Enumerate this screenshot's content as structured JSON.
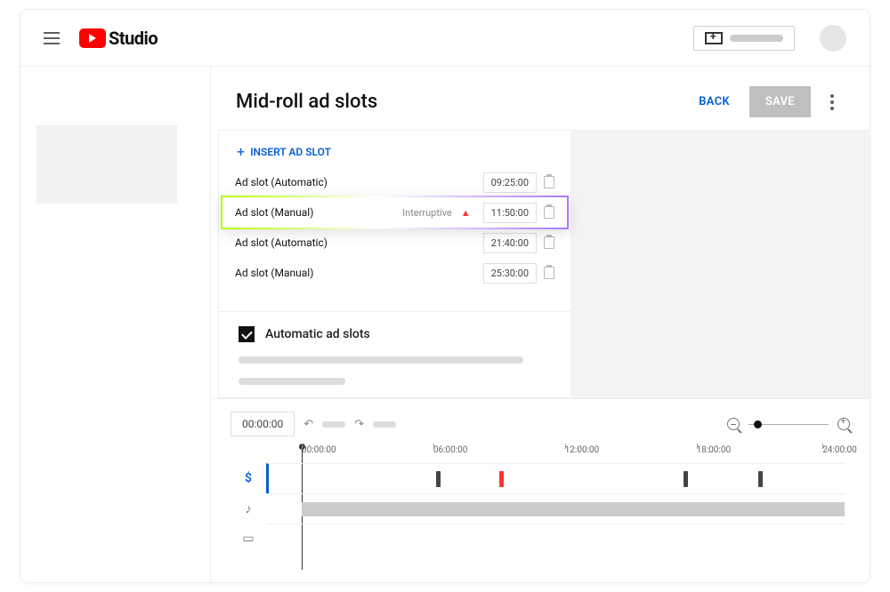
{
  "header": {
    "logo_text": "Studio"
  },
  "page": {
    "title": "Mid-roll ad slots",
    "back_label": "BACK",
    "save_label": "SAVE"
  },
  "panel": {
    "insert_label": "INSERT AD SLOT",
    "slots": [
      {
        "label": "Ad slot (Automatic)",
        "time": "09:25:00",
        "warn": "",
        "highlight": false
      },
      {
        "label": "Ad slot (Manual)",
        "time": "11:50:00",
        "warn": "Interruptive",
        "highlight": true
      },
      {
        "label": "Ad slot (Automatic)",
        "time": "21:40:00",
        "warn": "",
        "highlight": false
      },
      {
        "label": "Ad slot (Manual)",
        "time": "25:30:00",
        "warn": "",
        "highlight": false
      }
    ],
    "auto_label": "Automatic ad slots",
    "auto_checked": true
  },
  "timeline": {
    "current_time": "00:00:00",
    "ticks": [
      "00:00:00",
      "06:00:00",
      "12:00:00",
      "18:00:00",
      "24:00:00"
    ],
    "markers": [
      {
        "pos_pct": 29,
        "red": false
      },
      {
        "pos_pct": 40,
        "red": true
      },
      {
        "pos_pct": 72,
        "red": false
      },
      {
        "pos_pct": 85,
        "red": false
      }
    ],
    "row_icons": {
      "ads": "$",
      "music": "♪",
      "video": "▭"
    }
  }
}
